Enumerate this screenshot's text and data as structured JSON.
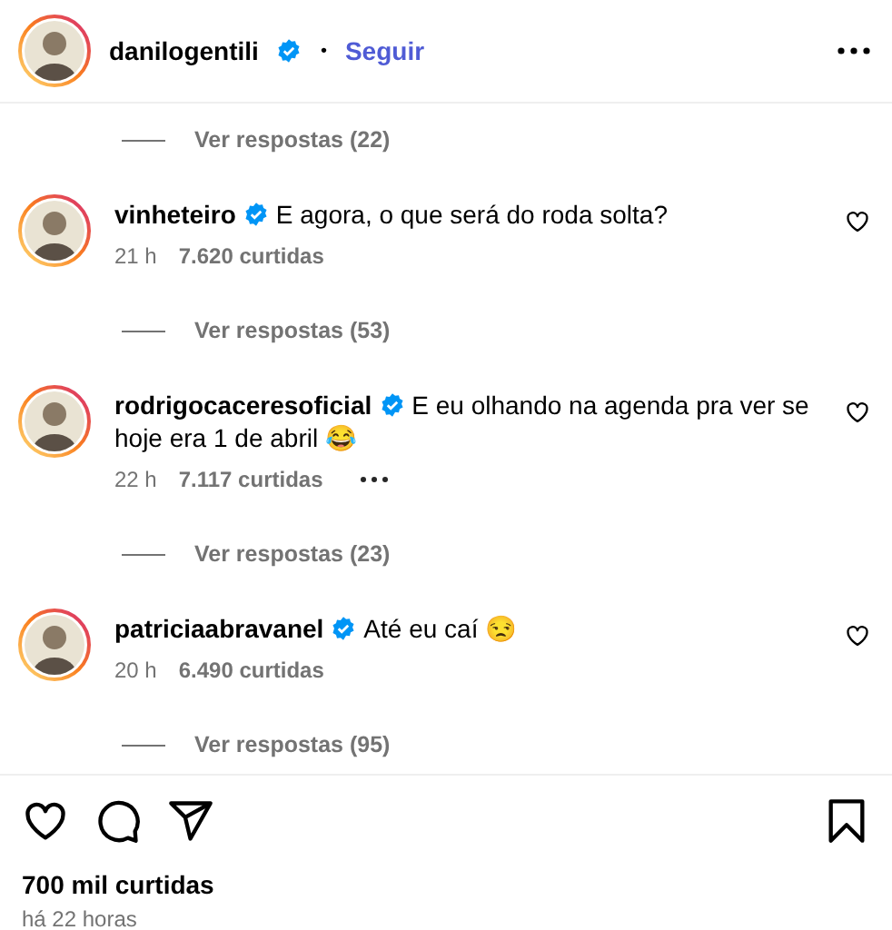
{
  "post_header": {
    "username": "danilogentili",
    "verified": true,
    "separator": "•",
    "follow": "Seguir"
  },
  "comments": [
    {
      "kind": "replies",
      "label": "Ver respostas (22)"
    },
    {
      "kind": "comment",
      "username": "vinheteiro",
      "verified": true,
      "text": "E agora, o que será do roda solta?",
      "time": "21 h",
      "likes": "7.620 curtidas",
      "more": false
    },
    {
      "kind": "replies",
      "label": "Ver respostas (53)"
    },
    {
      "kind": "comment",
      "username": "rodrigocaceresoficial",
      "verified": true,
      "text": "E eu olhando na agenda pra ver se hoje era 1 de abril 😂",
      "time": "22 h",
      "likes": "7.117 curtidas",
      "more": true
    },
    {
      "kind": "replies",
      "label": "Ver respostas (23)"
    },
    {
      "kind": "comment",
      "username": "patriciaabravanel",
      "verified": true,
      "text": "Até eu caí 😒",
      "time": "20 h",
      "likes": "6.490 curtidas",
      "more": false
    },
    {
      "kind": "replies",
      "label": "Ver respostas (95)"
    }
  ],
  "footer": {
    "likes": "700 mil curtidas",
    "time": "há 22 horas"
  }
}
